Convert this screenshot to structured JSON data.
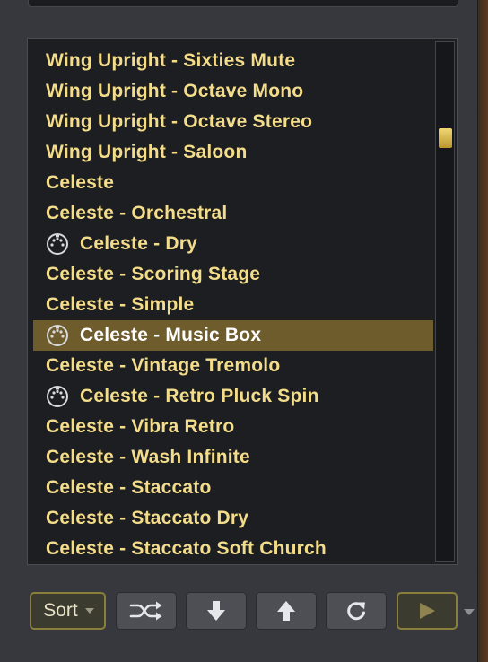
{
  "patch_list": {
    "items": [
      {
        "label": "Wing Upright - Sixties Mute",
        "has_icon": false,
        "selected": false
      },
      {
        "label": "Wing Upright - Octave Mono",
        "has_icon": false,
        "selected": false
      },
      {
        "label": "Wing Upright - Octave Stereo",
        "has_icon": false,
        "selected": false
      },
      {
        "label": "Wing Upright - Saloon",
        "has_icon": false,
        "selected": false
      },
      {
        "label": "Celeste",
        "has_icon": false,
        "selected": false
      },
      {
        "label": "Celeste - Orchestral",
        "has_icon": false,
        "selected": false
      },
      {
        "label": "Celeste - Dry",
        "has_icon": true,
        "selected": false
      },
      {
        "label": "Celeste - Scoring Stage",
        "has_icon": false,
        "selected": false
      },
      {
        "label": "Celeste - Simple",
        "has_icon": false,
        "selected": false
      },
      {
        "label": "Celeste - Music Box",
        "has_icon": true,
        "selected": true
      },
      {
        "label": "Celeste - Vintage Tremolo",
        "has_icon": false,
        "selected": false
      },
      {
        "label": "Celeste - Retro Pluck Spin",
        "has_icon": true,
        "selected": false
      },
      {
        "label": "Celeste - Vibra Retro",
        "has_icon": false,
        "selected": false
      },
      {
        "label": "Celeste - Wash Infinite",
        "has_icon": false,
        "selected": false
      },
      {
        "label": "Celeste - Staccato",
        "has_icon": false,
        "selected": false
      },
      {
        "label": "Celeste - Staccato Dry",
        "has_icon": false,
        "selected": false
      },
      {
        "label": "Celeste - Staccato Soft Church",
        "has_icon": false,
        "selected": false
      }
    ],
    "item_icon": "midi-connector-icon",
    "scroll_position": 0.17
  },
  "toolbar": {
    "sort_label": "Sort",
    "buttons": [
      {
        "name": "shuffle-button",
        "icon": "shuffle-icon"
      },
      {
        "name": "move-down-button",
        "icon": "arrow-down-icon"
      },
      {
        "name": "move-up-button",
        "icon": "arrow-up-icon"
      },
      {
        "name": "refresh-button",
        "icon": "refresh-icon"
      },
      {
        "name": "play-button",
        "icon": "play-icon"
      }
    ]
  },
  "colors": {
    "item_text": "#f4dd8a",
    "selected_bg": "#6e5c2c",
    "selected_text": "#ffffff",
    "list_bg": "#1d1e21",
    "panel_bg": "#36383d",
    "accent": "#8a7e3d"
  }
}
